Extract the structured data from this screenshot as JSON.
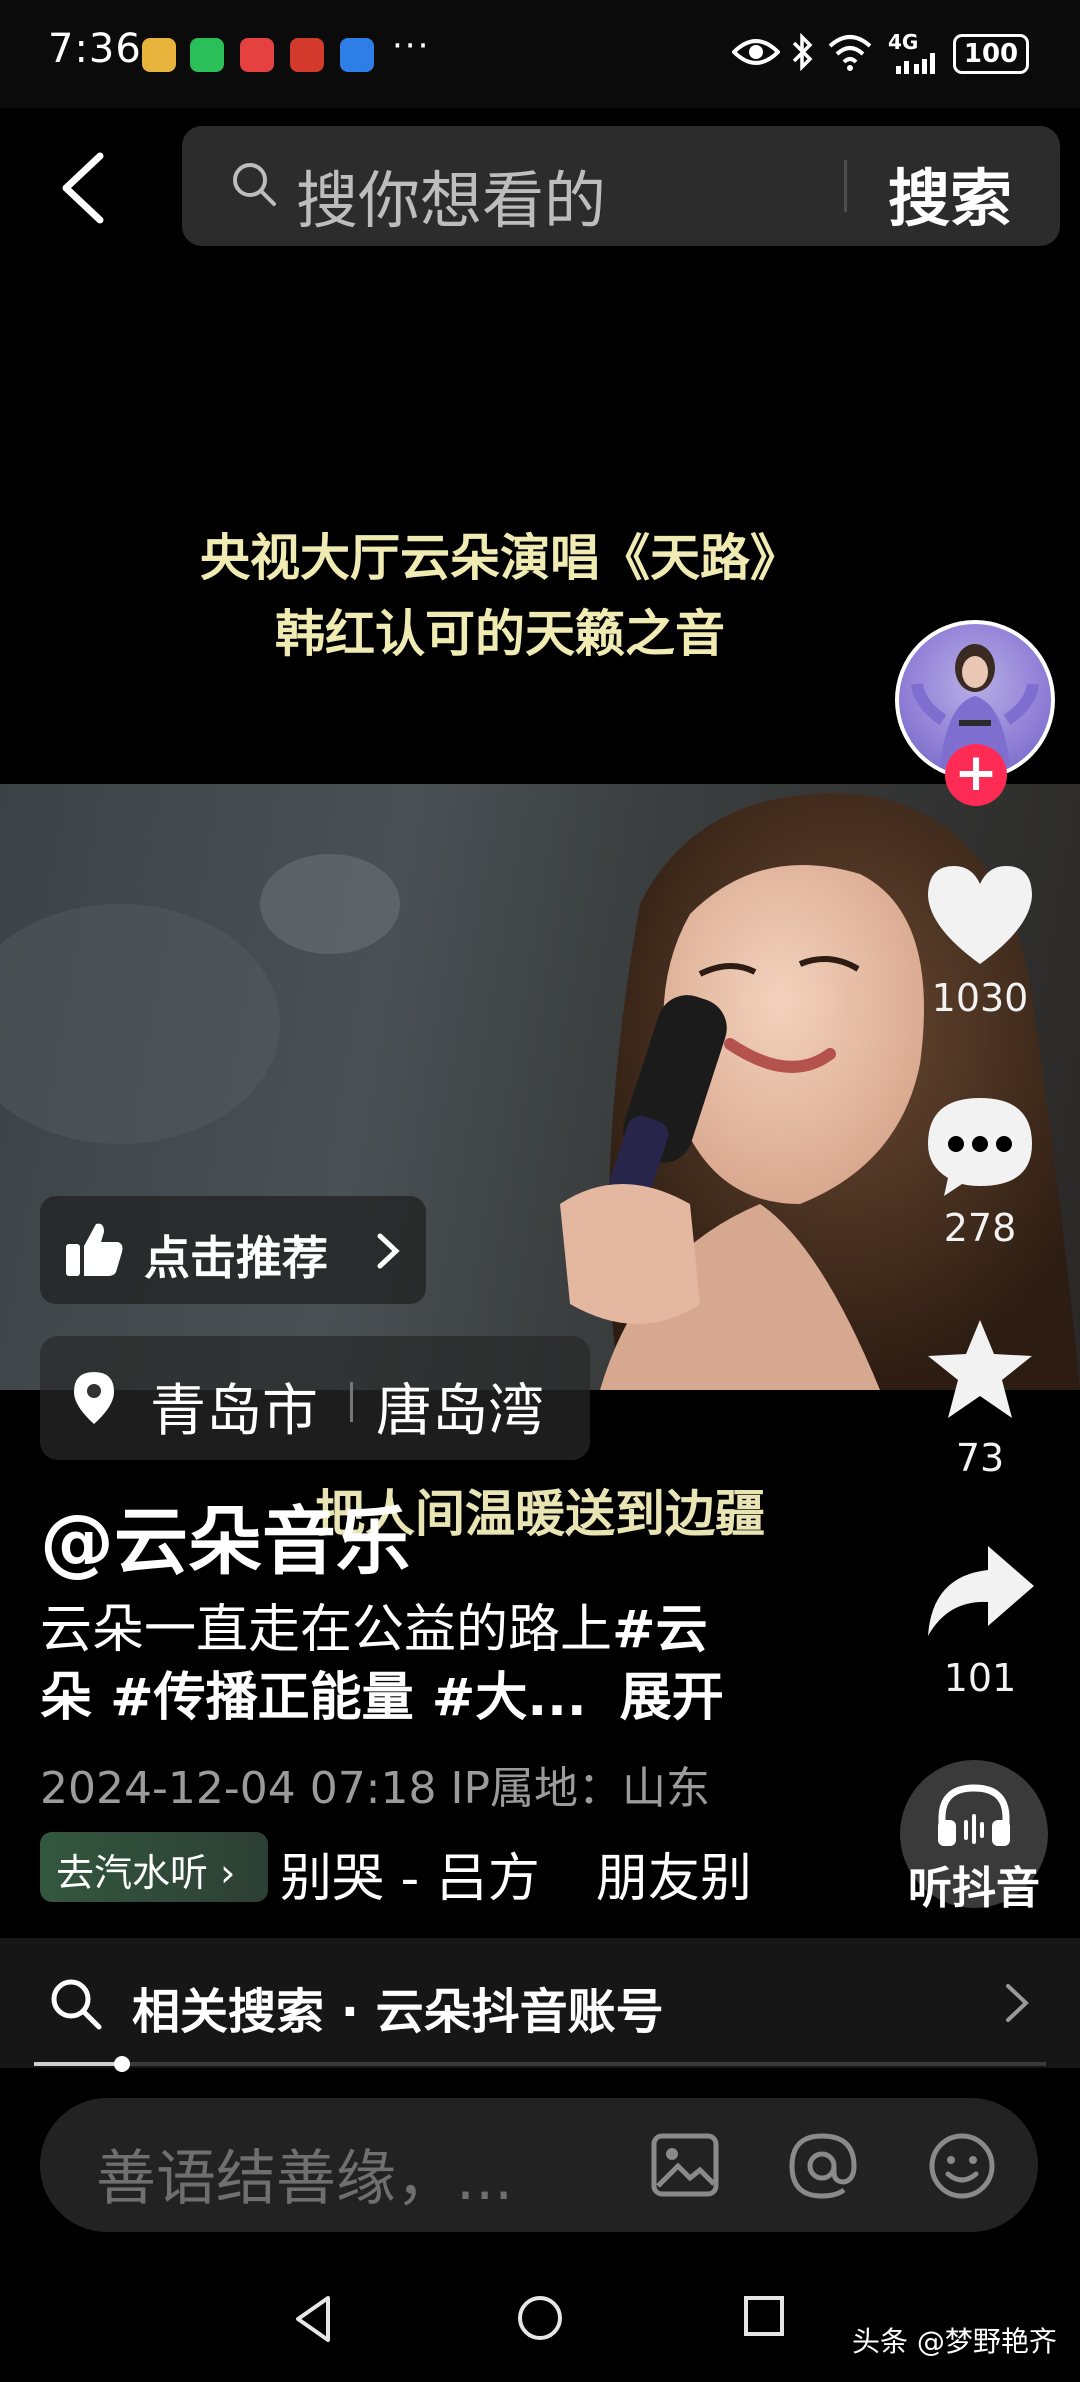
{
  "status_bar": {
    "time": "7:36",
    "more": "···",
    "network": "4G",
    "battery": "100",
    "app_icons": [
      "#e8b43b",
      "#2bbf5a",
      "#e64141",
      "#d33a2c",
      "#2d7ee6"
    ]
  },
  "search": {
    "placeholder": "搜你想看的",
    "button": "搜索"
  },
  "video": {
    "caption_line1": "央视大厅云朵演唱《天路》",
    "caption_line2": "韩红认可的天籁之音",
    "subtitle": "把人间温暖送到边疆"
  },
  "actions": {
    "likes": "1030",
    "comments": "278",
    "favorites": "73",
    "shares": "101"
  },
  "recommend": {
    "label": "点击推荐"
  },
  "location": {
    "city": "青岛市",
    "place": "唐岛湾"
  },
  "post": {
    "author": "@云朵音乐",
    "desc_plain": "云朵一直走在公益的路上",
    "desc_tag1": "#云",
    "desc_line2": "朵 #传播正能量 #大...",
    "expand": "展开",
    "meta": "2024-12-04 07:18  IP属地：山东"
  },
  "music": {
    "chip": "去汽水听 ›",
    "track1": "别哭 - 吕方",
    "track2": "朋友别"
  },
  "listen": {
    "label": "听抖音"
  },
  "related": {
    "label": "相关搜索 · 云朵抖音账号"
  },
  "comment": {
    "placeholder": "善语结善缘，..."
  },
  "watermark": "头条 @梦野艳齐",
  "colors": {
    "accent": "#fe2c55",
    "caption": "#f0ebb3"
  }
}
